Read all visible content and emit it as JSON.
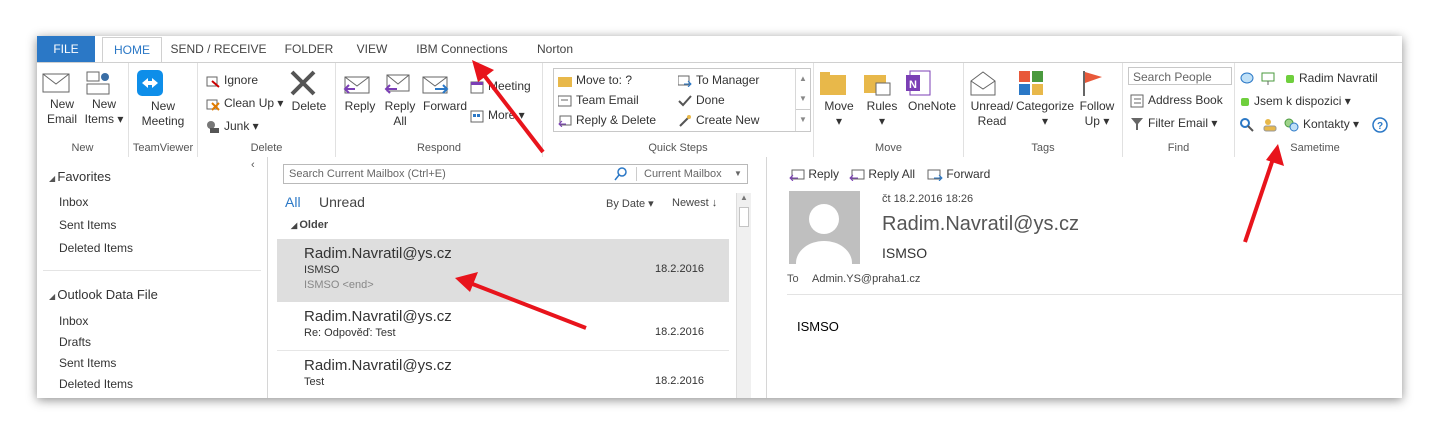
{
  "tabs": [
    "FILE",
    "HOME",
    "SEND / RECEIVE",
    "FOLDER",
    "VIEW",
    "IBM Connections",
    "Norton"
  ],
  "ribbon": {
    "new_email": [
      "New",
      "Email"
    ],
    "new_items": [
      "New",
      "Items ▾"
    ],
    "new_group": "New",
    "new_meeting": [
      "New",
      "Meeting"
    ],
    "teamviewer_group": "TeamViewer",
    "ignore": "Ignore",
    "clean_up": "Clean Up ▾",
    "junk": "Junk ▾",
    "delete": "Delete",
    "delete_group": "Delete",
    "reply": "Reply",
    "reply_all": [
      "Reply",
      "All"
    ],
    "forward": "Forward",
    "meeting": "Meeting",
    "more": "More ▾",
    "respond_group": "Respond",
    "qs_move_to": "Move to: ?",
    "qs_team_email": "Team Email",
    "qs_reply_delete": "Reply & Delete",
    "qs_to_manager": "To Manager",
    "qs_done": "Done",
    "qs_create_new": "Create New",
    "quick_steps_group": "Quick Steps",
    "move": "Move",
    "rules": "Rules",
    "onenote": "OneNote",
    "move_group": "Move",
    "unread_read": [
      "Unread/",
      "Read"
    ],
    "categorize": "Categorize",
    "follow_up": [
      "Follow",
      "Up ▾"
    ],
    "tags_group": "Tags",
    "search_people": "Search People",
    "address_book": "Address Book",
    "filter_email": "Filter Email ▾",
    "find_group": "Find",
    "st_name": "Radim Navratil",
    "st_status": "Jsem k dispozici ▾",
    "st_contacts": "Kontakty ▾",
    "sametime_group": "Sametime"
  },
  "nav": {
    "favorites": "Favorites",
    "fav_items": [
      "Inbox",
      "Sent Items",
      "Deleted Items"
    ],
    "data_file": "Outlook Data File",
    "df_items": [
      "Inbox",
      "Drafts",
      "Sent Items",
      "Deleted Items"
    ]
  },
  "list": {
    "search_placeholder": "Search Current Mailbox (Ctrl+E)",
    "scope": "Current Mailbox",
    "filter_all": "All",
    "filter_unread": "Unread",
    "sort_by": "By Date ▾",
    "order": "Newest ↓",
    "group_label": "Older",
    "messages": [
      {
        "from": "Radim.Navratil@ys.cz",
        "subject": "ISMSO",
        "preview": "ISMSO <end>",
        "date": "18.2.2016"
      },
      {
        "from": "Radim.Navratil@ys.cz",
        "subject": "Re: Odpověď: Test",
        "preview": "",
        "date": "18.2.2016"
      },
      {
        "from": "Radim.Navratil@ys.cz",
        "subject": "Test",
        "preview": "",
        "date": "18.2.2016"
      }
    ]
  },
  "reading": {
    "reply": "Reply",
    "reply_all": "Reply All",
    "forward": "Forward",
    "datetime": "čt 18.2.2016 18:26",
    "sender": "Radim.Navratil@ys.cz",
    "subject": "ISMSO",
    "to_label": "To",
    "to_value": "Admin.YS@praha1.cz",
    "body": "ISMSO"
  },
  "colors": {
    "accent": "#2b78c6",
    "arrow": "#e8141c",
    "selected_row": "#dedede"
  }
}
